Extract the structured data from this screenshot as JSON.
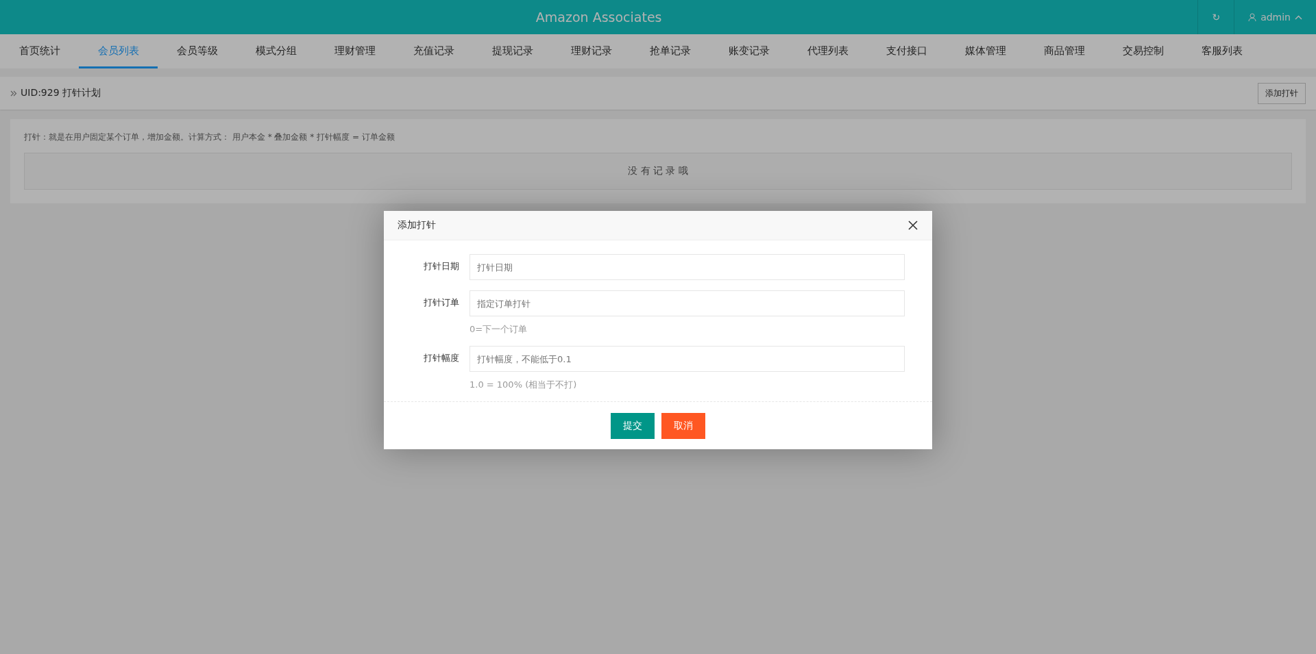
{
  "header": {
    "title": "Amazon Associates",
    "refresh": "↻",
    "user": "admin"
  },
  "nav": [
    {
      "label": "首页统计",
      "selected": false
    },
    {
      "label": "会员列表",
      "selected": true
    },
    {
      "label": "会员等级",
      "selected": false
    },
    {
      "label": "模式分组",
      "selected": false
    },
    {
      "label": "理财管理",
      "selected": false
    },
    {
      "label": "充值记录",
      "selected": false
    },
    {
      "label": "提现记录",
      "selected": false
    },
    {
      "label": "理财记录",
      "selected": false
    },
    {
      "label": "抢单记录",
      "selected": false
    },
    {
      "label": "账变记录",
      "selected": false
    },
    {
      "label": "代理列表",
      "selected": false
    },
    {
      "label": "支付接口",
      "selected": false
    },
    {
      "label": "媒体管理",
      "selected": false
    },
    {
      "label": "商品管理",
      "selected": false
    },
    {
      "label": "交易控制",
      "selected": false
    },
    {
      "label": "客服列表",
      "selected": false
    }
  ],
  "breadcrumb": "UID:929 打针计划",
  "add_button": "添加打针",
  "notice": "打针：就是在用户固定某个订单，增加金额。计算方式： 用户本金 * 叠加金额 * 打针幅度 = 订单金额",
  "empty": "没 有 记 录 哦",
  "dialog": {
    "title": "添加打针",
    "fields": [
      {
        "label": "打针日期",
        "placeholder": "打针日期"
      },
      {
        "label": "打针订单",
        "placeholder": "指定订单打针",
        "hint": "0=下一个订单"
      },
      {
        "label": "打针幅度",
        "placeholder": "打针幅度，不能低于0.1",
        "hint": "1.0 = 100% (相当于不打)"
      }
    ],
    "buttons": [
      {
        "label": "提交",
        "kind": "primary"
      },
      {
        "label": "取消",
        "kind": "danger"
      }
    ]
  }
}
